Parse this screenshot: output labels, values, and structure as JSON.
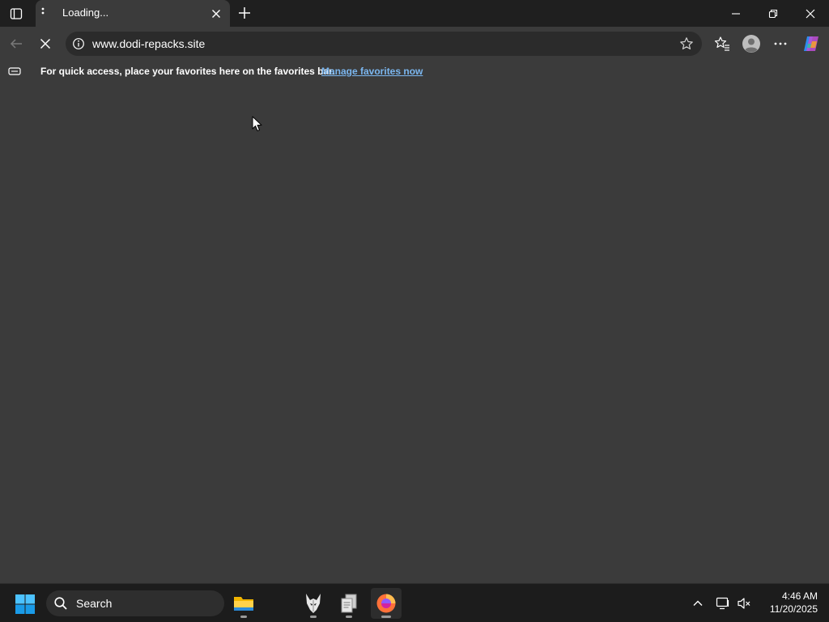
{
  "browser": {
    "tab": {
      "title": "Loading..."
    },
    "address_bar": {
      "url": "www.dodi-repacks.site"
    },
    "favorites_bar": {
      "message": "For quick access, place your favorites here on the favorites bar.",
      "link": "Manage favorites now"
    }
  },
  "taskbar": {
    "search_label": "Search",
    "apps": [
      {
        "name": "File Explorer"
      },
      {
        "name": "Wolf app"
      },
      {
        "name": "Document app"
      },
      {
        "name": "Firefox"
      }
    ],
    "clock": {
      "time": "4:46 AM",
      "date": "11/20/2025"
    }
  },
  "colors": {
    "tabstrip_bg": "#1f1f1f",
    "page_bg": "#3b3b3b",
    "link": "#7bb7f0",
    "taskbar_bg": "#1c1c1c"
  }
}
